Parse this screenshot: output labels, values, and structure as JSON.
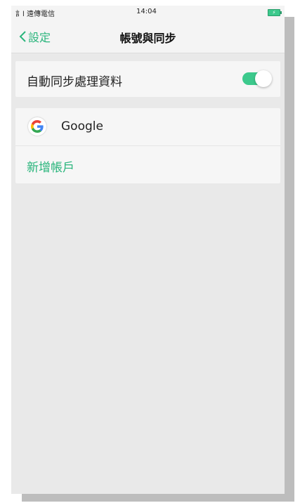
{
  "status_bar": {
    "carrier": "訁l 遠傳電信",
    "time": "14:04",
    "battery_icon": "battery-charging-icon"
  },
  "nav": {
    "back_label": "設定",
    "title": "帳號與同步"
  },
  "sync": {
    "label": "自動同步處理資料",
    "enabled": true
  },
  "accounts": {
    "items": [
      {
        "label": "Google",
        "icon": "google-icon"
      }
    ],
    "add_label": "新增帳戶"
  },
  "colors": {
    "accent": "#2ab57c",
    "toggle_on": "#3cc98c",
    "background": "#e9e9e9",
    "card": "#f6f6f6"
  }
}
